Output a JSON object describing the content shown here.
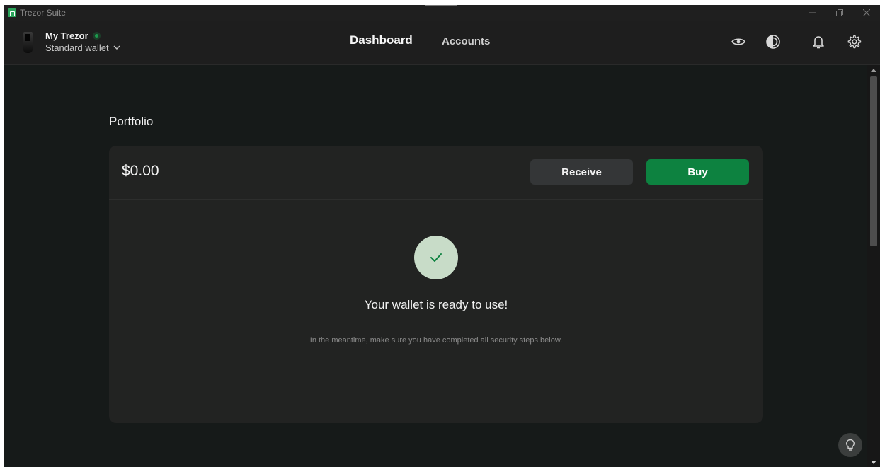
{
  "window": {
    "title": "Trezor Suite"
  },
  "header": {
    "device_name": "My Trezor",
    "wallet_type": "Standard wallet",
    "nav": {
      "dashboard": "Dashboard",
      "accounts": "Accounts"
    },
    "icons": [
      "eye-icon",
      "theme-icon",
      "bell-icon",
      "gear-icon"
    ]
  },
  "main": {
    "section_title": "Portfolio",
    "balance": "$0.00",
    "receive_label": "Receive",
    "buy_label": "Buy",
    "ready_title": "Your wallet is ready to use!",
    "ready_subtitle": "In the meantime, make sure you have completed all security steps below."
  },
  "colors": {
    "accent_green": "#0d8240",
    "status_dot": "#1d9a4d",
    "background": "#161a19",
    "card": "#222322"
  }
}
